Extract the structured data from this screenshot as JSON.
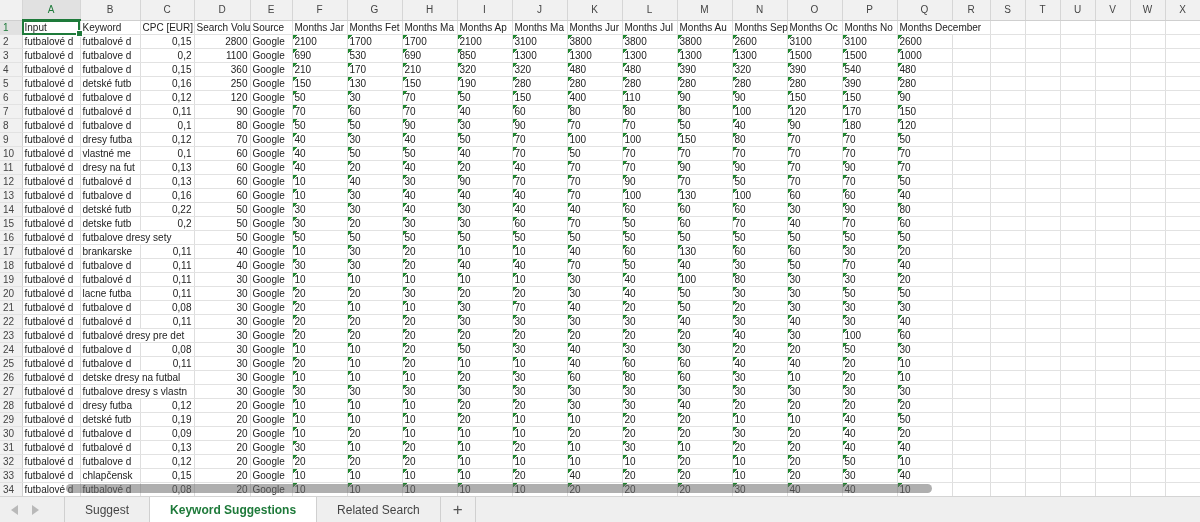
{
  "columns": [
    {
      "label": "A",
      "selected": true
    },
    {
      "label": "B",
      "selected": false
    },
    {
      "label": "C",
      "selected": false
    },
    {
      "label": "D",
      "selected": false
    },
    {
      "label": "E",
      "selected": false
    },
    {
      "label": "F",
      "selected": false
    },
    {
      "label": "G",
      "selected": false
    },
    {
      "label": "H",
      "selected": false
    },
    {
      "label": "I",
      "selected": false
    },
    {
      "label": "J",
      "selected": false
    },
    {
      "label": "K",
      "selected": false
    },
    {
      "label": "L",
      "selected": false
    },
    {
      "label": "M",
      "selected": false
    },
    {
      "label": "N",
      "selected": false
    },
    {
      "label": "O",
      "selected": false
    },
    {
      "label": "P",
      "selected": false
    },
    {
      "label": "Q",
      "selected": false
    },
    {
      "label": "R",
      "selected": false
    },
    {
      "label": "S",
      "selected": false
    },
    {
      "label": "T",
      "selected": false
    },
    {
      "label": "U",
      "selected": false
    },
    {
      "label": "V",
      "selected": false
    },
    {
      "label": "W",
      "selected": false
    },
    {
      "label": "X",
      "selected": false
    }
  ],
  "header_row": {
    "number": "1",
    "selected": true,
    "cells": [
      "Input",
      "Keyword",
      "CPC [EUR]",
      "Search Volu",
      "Source",
      "Months Jar",
      "Months Fet",
      "Months Ma",
      "Months Ap",
      "Months Ma",
      "Months Jur",
      "Months Jul",
      "Months Au",
      "Months Sep",
      "Months Oc",
      "Months No",
      "Months December"
    ]
  },
  "rows": [
    {
      "number": "2",
      "input": "futbalové d",
      "keyword": "futbalové d",
      "cpc": "0,15",
      "volume": "2800",
      "source": "Google",
      "months": [
        "2100",
        "1700",
        "1700",
        "2100",
        "3100",
        "3800",
        "3800",
        "3800",
        "2600",
        "3100",
        "3100",
        "2600"
      ]
    },
    {
      "number": "3",
      "input": "futbalové d",
      "keyword": "futbalove d",
      "cpc": "0,2",
      "volume": "1100",
      "source": "Google",
      "months": [
        "690",
        "530",
        "690",
        "850",
        "1300",
        "1300",
        "1300",
        "1300",
        "1300",
        "1500",
        "1500",
        "1000"
      ]
    },
    {
      "number": "4",
      "input": "futbalové d",
      "keyword": "futbalove d",
      "cpc": "0,15",
      "volume": "360",
      "source": "Google",
      "months": [
        "210",
        "170",
        "210",
        "320",
        "320",
        "480",
        "480",
        "390",
        "320",
        "390",
        "540",
        "480"
      ]
    },
    {
      "number": "5",
      "input": "futbalové d",
      "keyword": "detské futb",
      "cpc": "0,16",
      "volume": "250",
      "source": "Google",
      "months": [
        "150",
        "130",
        "150",
        "190",
        "280",
        "280",
        "280",
        "280",
        "280",
        "280",
        "390",
        "280"
      ]
    },
    {
      "number": "6",
      "input": "futbalové d",
      "keyword": "futbalove d",
      "cpc": "0,12",
      "volume": "120",
      "source": "Google",
      "months": [
        "50",
        "30",
        "70",
        "50",
        "150",
        "400",
        "110",
        "90",
        "90",
        "150",
        "150",
        "90"
      ]
    },
    {
      "number": "7",
      "input": "futbalové d",
      "keyword": "futbalové d",
      "cpc": "0,11",
      "volume": "90",
      "source": "Google",
      "months": [
        "70",
        "60",
        "70",
        "40",
        "60",
        "80",
        "80",
        "80",
        "100",
        "120",
        "170",
        "150"
      ]
    },
    {
      "number": "8",
      "input": "futbalové d",
      "keyword": "futbalove d",
      "cpc": "0,1",
      "volume": "80",
      "source": "Google",
      "months": [
        "50",
        "50",
        "90",
        "30",
        "90",
        "70",
        "70",
        "50",
        "40",
        "90",
        "180",
        "120"
      ]
    },
    {
      "number": "9",
      "input": "futbalové d",
      "keyword": "dresy futba",
      "cpc": "0,12",
      "volume": "70",
      "source": "Google",
      "months": [
        "40",
        "30",
        "40",
        "50",
        "70",
        "100",
        "100",
        "150",
        "80",
        "70",
        "70",
        "50"
      ]
    },
    {
      "number": "10",
      "input": "futbalové d",
      "keyword": "vlastné me",
      "cpc": "0,1",
      "volume": "60",
      "source": "Google",
      "months": [
        "40",
        "50",
        "50",
        "40",
        "70",
        "50",
        "70",
        "70",
        "70",
        "70",
        "70",
        "70"
      ]
    },
    {
      "number": "11",
      "input": "futbalové d",
      "keyword": "dresy na fut",
      "cpc": "0,13",
      "volume": "60",
      "source": "Google",
      "months": [
        "40",
        "20",
        "40",
        "20",
        "40",
        "70",
        "70",
        "90",
        "90",
        "70",
        "90",
        "70"
      ]
    },
    {
      "number": "12",
      "input": "futbalové d",
      "keyword": "futbalové d",
      "cpc": "0,13",
      "volume": "60",
      "source": "Google",
      "months": [
        "10",
        "40",
        "30",
        "90",
        "70",
        "70",
        "90",
        "70",
        "50",
        "70",
        "70",
        "50"
      ]
    },
    {
      "number": "13",
      "input": "futbalové d",
      "keyword": "futbalove d",
      "cpc": "0,16",
      "volume": "60",
      "source": "Google",
      "months": [
        "10",
        "30",
        "40",
        "40",
        "40",
        "70",
        "100",
        "130",
        "100",
        "60",
        "60",
        "40"
      ]
    },
    {
      "number": "14",
      "input": "futbalové d",
      "keyword": "detské futb",
      "cpc": "0,22",
      "volume": "50",
      "source": "Google",
      "months": [
        "30",
        "30",
        "40",
        "30",
        "40",
        "40",
        "60",
        "60",
        "60",
        "30",
        "90",
        "80"
      ]
    },
    {
      "number": "15",
      "input": "futbalové d",
      "keyword": "detske futb",
      "cpc": "0,2",
      "volume": "50",
      "source": "Google",
      "months": [
        "30",
        "20",
        "30",
        "30",
        "60",
        "70",
        "50",
        "60",
        "70",
        "40",
        "70",
        "60"
      ]
    },
    {
      "number": "16",
      "input": "futbalové d",
      "keyword": "futbalove dresy sety",
      "volume": "50",
      "source": "Google",
      "months": [
        "50",
        "50",
        "50",
        "50",
        "50",
        "50",
        "50",
        "50",
        "50",
        "50",
        "50",
        "50"
      ]
    },
    {
      "number": "17",
      "input": "futbalové d",
      "keyword": "brankarske",
      "cpc": "0,11",
      "volume": "40",
      "source": "Google",
      "months": [
        "10",
        "30",
        "20",
        "10",
        "10",
        "40",
        "60",
        "130",
        "60",
        "60",
        "30",
        "20"
      ]
    },
    {
      "number": "18",
      "input": "futbalové d",
      "keyword": "futbalove d",
      "cpc": "0,11",
      "volume": "40",
      "source": "Google",
      "months": [
        "30",
        "30",
        "20",
        "40",
        "40",
        "70",
        "50",
        "40",
        "30",
        "50",
        "70",
        "40"
      ]
    },
    {
      "number": "19",
      "input": "futbalové d",
      "keyword": "futbalové d",
      "cpc": "0,11",
      "volume": "30",
      "source": "Google",
      "months": [
        "10",
        "10",
        "10",
        "10",
        "10",
        "30",
        "40",
        "100",
        "80",
        "30",
        "30",
        "20"
      ]
    },
    {
      "number": "20",
      "input": "futbalové d",
      "keyword": "lacne futba",
      "cpc": "0,11",
      "volume": "30",
      "source": "Google",
      "months": [
        "20",
        "20",
        "30",
        "20",
        "20",
        "30",
        "40",
        "50",
        "30",
        "30",
        "50",
        "50"
      ]
    },
    {
      "number": "21",
      "input": "futbalové d",
      "keyword": "futbalove d",
      "cpc": "0,08",
      "volume": "30",
      "source": "Google",
      "months": [
        "20",
        "10",
        "10",
        "30",
        "70",
        "40",
        "20",
        "50",
        "20",
        "30",
        "30",
        "30"
      ]
    },
    {
      "number": "22",
      "input": "futbalové d",
      "keyword": "futbalové d",
      "cpc": "0,11",
      "volume": "30",
      "source": "Google",
      "months": [
        "20",
        "20",
        "20",
        "30",
        "30",
        "30",
        "30",
        "40",
        "30",
        "40",
        "30",
        "40"
      ]
    },
    {
      "number": "23",
      "input": "futbalové d",
      "keyword": "futbalové dresy pre det",
      "volume": "30",
      "source": "Google",
      "months": [
        "20",
        "20",
        "20",
        "20",
        "20",
        "20",
        "20",
        "20",
        "40",
        "30",
        "100",
        "60"
      ]
    },
    {
      "number": "24",
      "input": "futbalové d",
      "keyword": "futbalove d",
      "cpc": "0,08",
      "volume": "30",
      "source": "Google",
      "months": [
        "10",
        "10",
        "20",
        "50",
        "30",
        "40",
        "30",
        "30",
        "20",
        "20",
        "50",
        "30"
      ]
    },
    {
      "number": "25",
      "input": "futbalové d",
      "keyword": "futbalove d",
      "cpc": "0,11",
      "volume": "30",
      "source": "Google",
      "months": [
        "20",
        "10",
        "20",
        "10",
        "10",
        "40",
        "60",
        "60",
        "40",
        "40",
        "20",
        "10"
      ]
    },
    {
      "number": "26",
      "input": "futbalové d",
      "keyword": "detske dresy na futbal",
      "volume": "30",
      "source": "Google",
      "months": [
        "10",
        "10",
        "10",
        "20",
        "30",
        "60",
        "80",
        "60",
        "30",
        "10",
        "20",
        "10"
      ]
    },
    {
      "number": "27",
      "input": "futbalové d",
      "keyword": "futbalove dresy s vlastn",
      "volume": "30",
      "source": "Google",
      "months": [
        "30",
        "30",
        "30",
        "30",
        "30",
        "30",
        "30",
        "30",
        "30",
        "30",
        "30",
        "30"
      ]
    },
    {
      "number": "28",
      "input": "futbalové d",
      "keyword": "dresy futba",
      "cpc": "0,12",
      "volume": "20",
      "source": "Google",
      "months": [
        "10",
        "10",
        "10",
        "20",
        "20",
        "30",
        "30",
        "40",
        "20",
        "20",
        "20",
        "20"
      ]
    },
    {
      "number": "29",
      "input": "futbalové d",
      "keyword": "detské futb",
      "cpc": "0,19",
      "volume": "20",
      "source": "Google",
      "months": [
        "10",
        "10",
        "10",
        "20",
        "10",
        "10",
        "20",
        "20",
        "10",
        "10",
        "40",
        "50"
      ]
    },
    {
      "number": "30",
      "input": "futbalové d",
      "keyword": "futbalove d",
      "cpc": "0,09",
      "volume": "20",
      "source": "Google",
      "months": [
        "10",
        "20",
        "10",
        "10",
        "10",
        "20",
        "20",
        "20",
        "30",
        "20",
        "40",
        "20"
      ]
    },
    {
      "number": "31",
      "input": "futbalové d",
      "keyword": "futbalové d",
      "cpc": "0,13",
      "volume": "20",
      "source": "Google",
      "months": [
        "30",
        "10",
        "20",
        "10",
        "20",
        "10",
        "30",
        "10",
        "20",
        "20",
        "40",
        "40"
      ]
    },
    {
      "number": "32",
      "input": "futbalové d",
      "keyword": "futbalove d",
      "cpc": "0,12",
      "volume": "20",
      "source": "Google",
      "months": [
        "20",
        "20",
        "20",
        "10",
        "10",
        "10",
        "10",
        "20",
        "10",
        "20",
        "50",
        "10"
      ]
    },
    {
      "number": "33",
      "input": "futbalové d",
      "keyword": "chlapčensk",
      "cpc": "0,15",
      "volume": "20",
      "source": "Google",
      "months": [
        "10",
        "10",
        "10",
        "10",
        "20",
        "40",
        "20",
        "20",
        "10",
        "20",
        "30",
        "40"
      ]
    },
    {
      "number": "34",
      "input": "futbalové d",
      "keyword": "futbalové d",
      "cpc": "0,08",
      "volume": "20",
      "source": "Google",
      "months": [
        "10",
        "10",
        "10",
        "10",
        "10",
        "20",
        "20",
        "20",
        "30",
        "40",
        "40",
        "10"
      ]
    }
  ],
  "sheet_tabs": [
    {
      "label": "Suggest",
      "selected": false
    },
    {
      "label": "Keyword Suggestions",
      "selected": true
    },
    {
      "label": "Related Search",
      "selected": false
    }
  ],
  "add_sheet": "+"
}
